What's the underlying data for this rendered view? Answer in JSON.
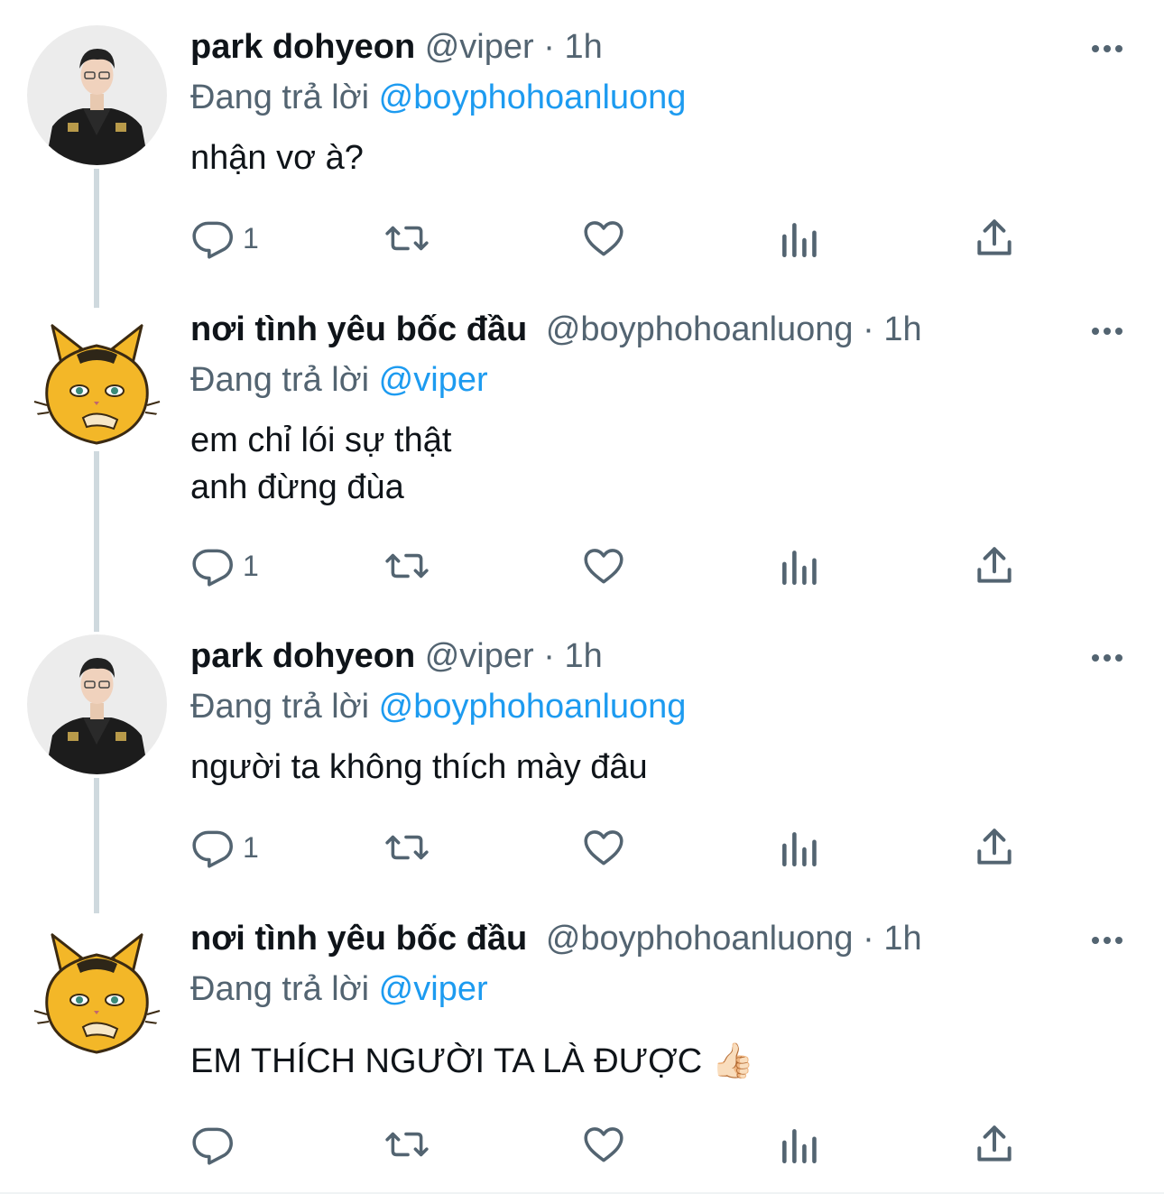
{
  "tweets": [
    {
      "name": "park dohyeon",
      "handle": "@viper",
      "separator": "·",
      "time": "1h",
      "replying_prefix": "Đang trả lời",
      "replying_to": "@boyphohoanluong",
      "text": "nhận vơ à?",
      "reply_count": "1",
      "avatar": "player-photo"
    },
    {
      "name": "nơi tình yêu bốc đầu",
      "handle": "@boyphohoanluong",
      "separator": "·",
      "time": "1h",
      "replying_prefix": "Đang trả lời",
      "replying_to": "@viper",
      "text": "em chỉ lói sự thật\nanh đừng đùa",
      "reply_count": "1",
      "avatar": "cat-cartoon"
    },
    {
      "name": "park dohyeon",
      "handle": "@viper",
      "separator": "·",
      "time": "1h",
      "replying_prefix": "Đang trả lời",
      "replying_to": "@boyphohoanluong",
      "text": "người ta không thích mày đâu",
      "reply_count": "1",
      "avatar": "player-photo"
    },
    {
      "name": "nơi tình yêu bốc đầu",
      "handle": "@boyphohoanluong",
      "separator": "·",
      "time": "1h",
      "replying_prefix": "Đang trả lời",
      "replying_to": "@viper",
      "text": "EM THÍCH NGƯỜI TA LÀ ĐƯỢC 👍🏻",
      "reply_count": "",
      "avatar": "cat-cartoon"
    }
  ],
  "colors": {
    "text": "#0f1419",
    "secondary": "#536471",
    "accent": "#1d9bf0",
    "thread_line": "#cfd9de"
  },
  "icons": [
    "reply-icon",
    "retweet-icon",
    "like-icon",
    "views-icon",
    "share-icon",
    "more-icon"
  ]
}
